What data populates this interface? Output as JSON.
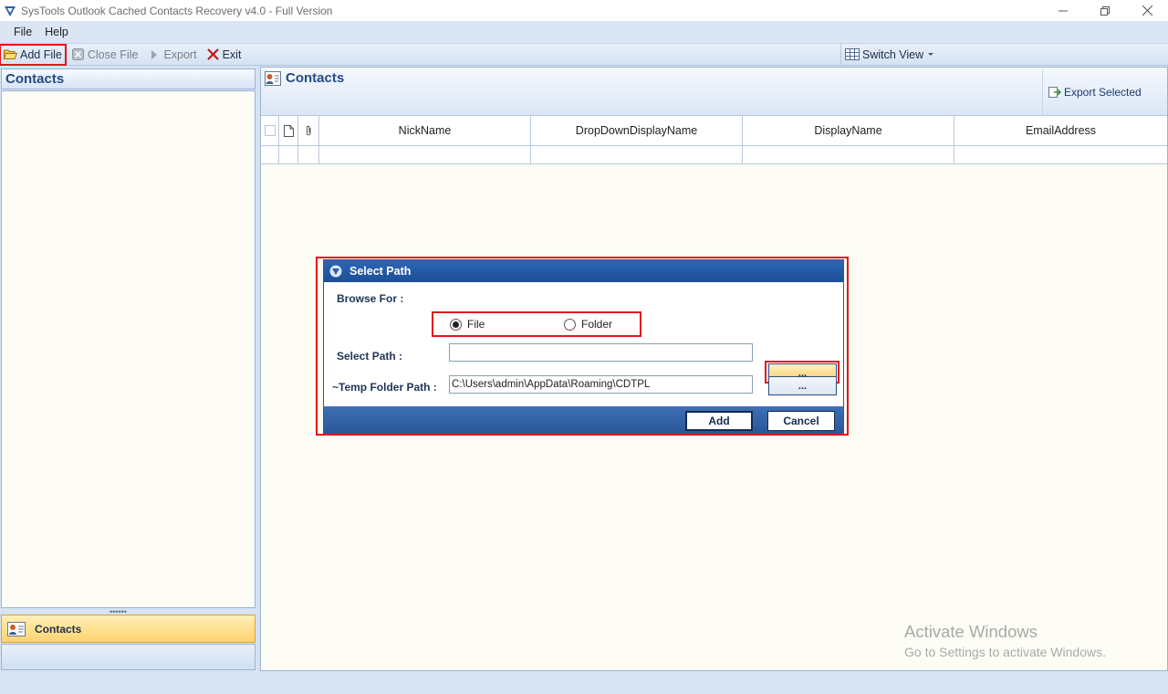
{
  "window": {
    "title": "SysTools Outlook Cached Contacts Recovery v4.0  - Full Version",
    "controls": [
      "minimize",
      "restore",
      "close"
    ]
  },
  "menu": [
    "File",
    "Help"
  ],
  "toolbar": {
    "add_file": "Add File",
    "close_file": "Close File",
    "export": "Export",
    "exit": "Exit",
    "switch_view": "Switch View"
  },
  "left_pane": {
    "header": "Contacts",
    "nav_item": "Contacts"
  },
  "right_pane": {
    "header": "Contacts",
    "export_selected": "Export Selected",
    "columns": [
      "NickName",
      "DropDownDisplayName",
      "DisplayName",
      "EmailAddress"
    ]
  },
  "dialog": {
    "title": "Select Path",
    "browse_for_label": "Browse For :",
    "radio_file": "File",
    "radio_folder": "Folder",
    "selected_option": "File",
    "select_path_label": "Select Path :",
    "select_path_value": "",
    "temp_path_label": "~Temp Folder Path :",
    "temp_path_value": "C:\\Users\\admin\\AppData\\Roaming\\CDTPL",
    "browse_label": "...",
    "add_button": "Add",
    "cancel_button": "Cancel"
  },
  "watermark": {
    "line1": "Activate Windows",
    "line2": "Go to Settings to activate Windows."
  },
  "colors": {
    "accent_blue": "#254a84",
    "highlight_red": "#e01818",
    "selected_nav": "#ffd36e"
  }
}
